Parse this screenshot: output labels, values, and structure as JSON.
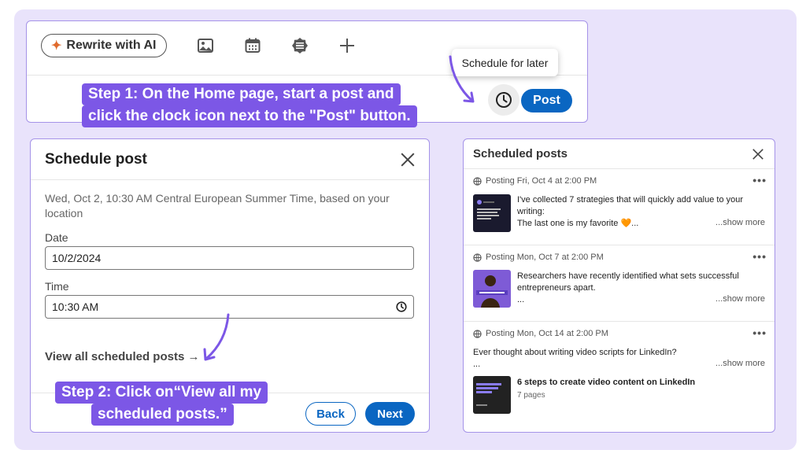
{
  "composer": {
    "ai_button_label": "Rewrite with AI",
    "tool_icons": [
      "image-icon",
      "calendar-icon",
      "badge-icon",
      "plus-icon"
    ],
    "tooltip": "Schedule for later",
    "post_button": "Post"
  },
  "callouts": {
    "step1_line1": "Step 1: On the Home page, start a post and",
    "step1_line2": "click the clock icon next to the \"Post\" button.",
    "step2_line1": "Step 2: Click on“View all my",
    "step2_line2": "scheduled posts.”"
  },
  "schedule_modal": {
    "title": "Schedule post",
    "description": "Wed, Oct 2, 10:30 AM Central European Summer Time, based on your location",
    "date_label": "Date",
    "date_value": "10/2/2024",
    "time_label": "Time",
    "time_value": "10:30 AM",
    "view_all": "View all scheduled posts →",
    "back": "Back",
    "next": "Next"
  },
  "scheduled_posts": {
    "title": "Scheduled posts",
    "items": [
      {
        "posting": "Posting Fri, Oct 4 at 2:00 PM",
        "line1": "I've collected 7 strategies that will quickly add value to your",
        "line2": "writing:",
        "line3": "The last one is my favorite 🧡...",
        "more": "...show more"
      },
      {
        "posting": "Posting Mon, Oct 7 at 2:00 PM",
        "line1": "Researchers have recently identified what sets successful",
        "line2": "entrepreneurs apart.",
        "line3": "...",
        "more": "...show more"
      },
      {
        "posting": "Posting Mon, Oct 14 at 2:00 PM",
        "line1": "Ever thought about writing video scripts for LinkedIn?",
        "line2": "...",
        "more": "...show more",
        "doc_title": "6 steps to create video content on LinkedIn",
        "doc_pages": "7 pages"
      }
    ]
  },
  "colors": {
    "accent": "#0a66c2",
    "callout": "#7c57e6",
    "background": "#e9e3fb",
    "card_border": "#a593e8"
  }
}
